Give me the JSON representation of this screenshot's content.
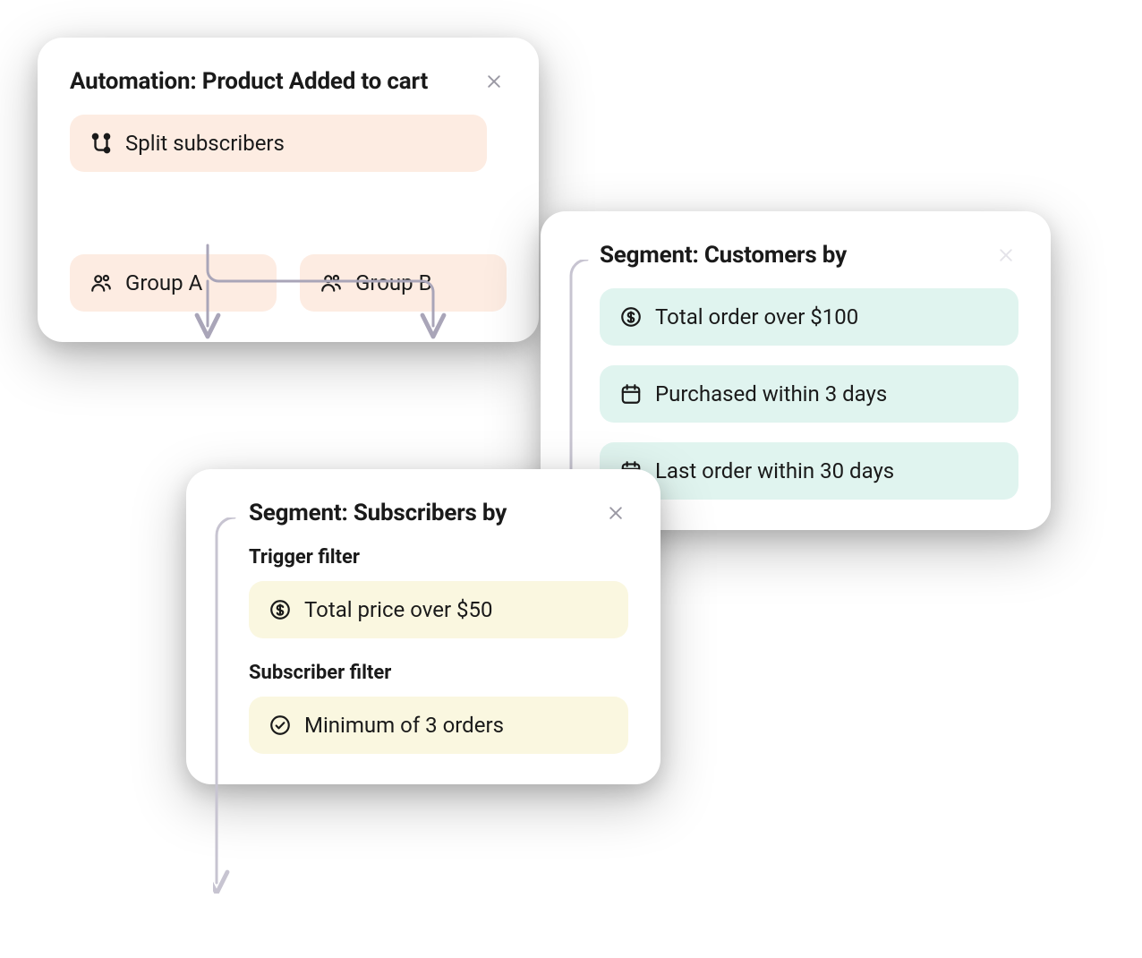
{
  "automation": {
    "title": "Automation: Product Added to cart",
    "split_label": "Split subscribers",
    "group_a_label": "Group A",
    "group_b_label": "Group B"
  },
  "customers": {
    "title": "Segment: Customers by",
    "filters": [
      {
        "icon": "dollar",
        "label": "Total order over $100"
      },
      {
        "icon": "calendar",
        "label": "Purchased within 3 days"
      },
      {
        "icon": "calendar",
        "label": "Last order within 30 days"
      }
    ]
  },
  "subscribers": {
    "title": "Segment: Subscribers by",
    "trigger_label": "Trigger filter",
    "trigger_filter": {
      "icon": "dollar",
      "label": "Total price over $50"
    },
    "subscriber_label": "Subscriber filter",
    "subscriber_filter": {
      "icon": "check",
      "label": "Minimum of 3 orders"
    }
  }
}
